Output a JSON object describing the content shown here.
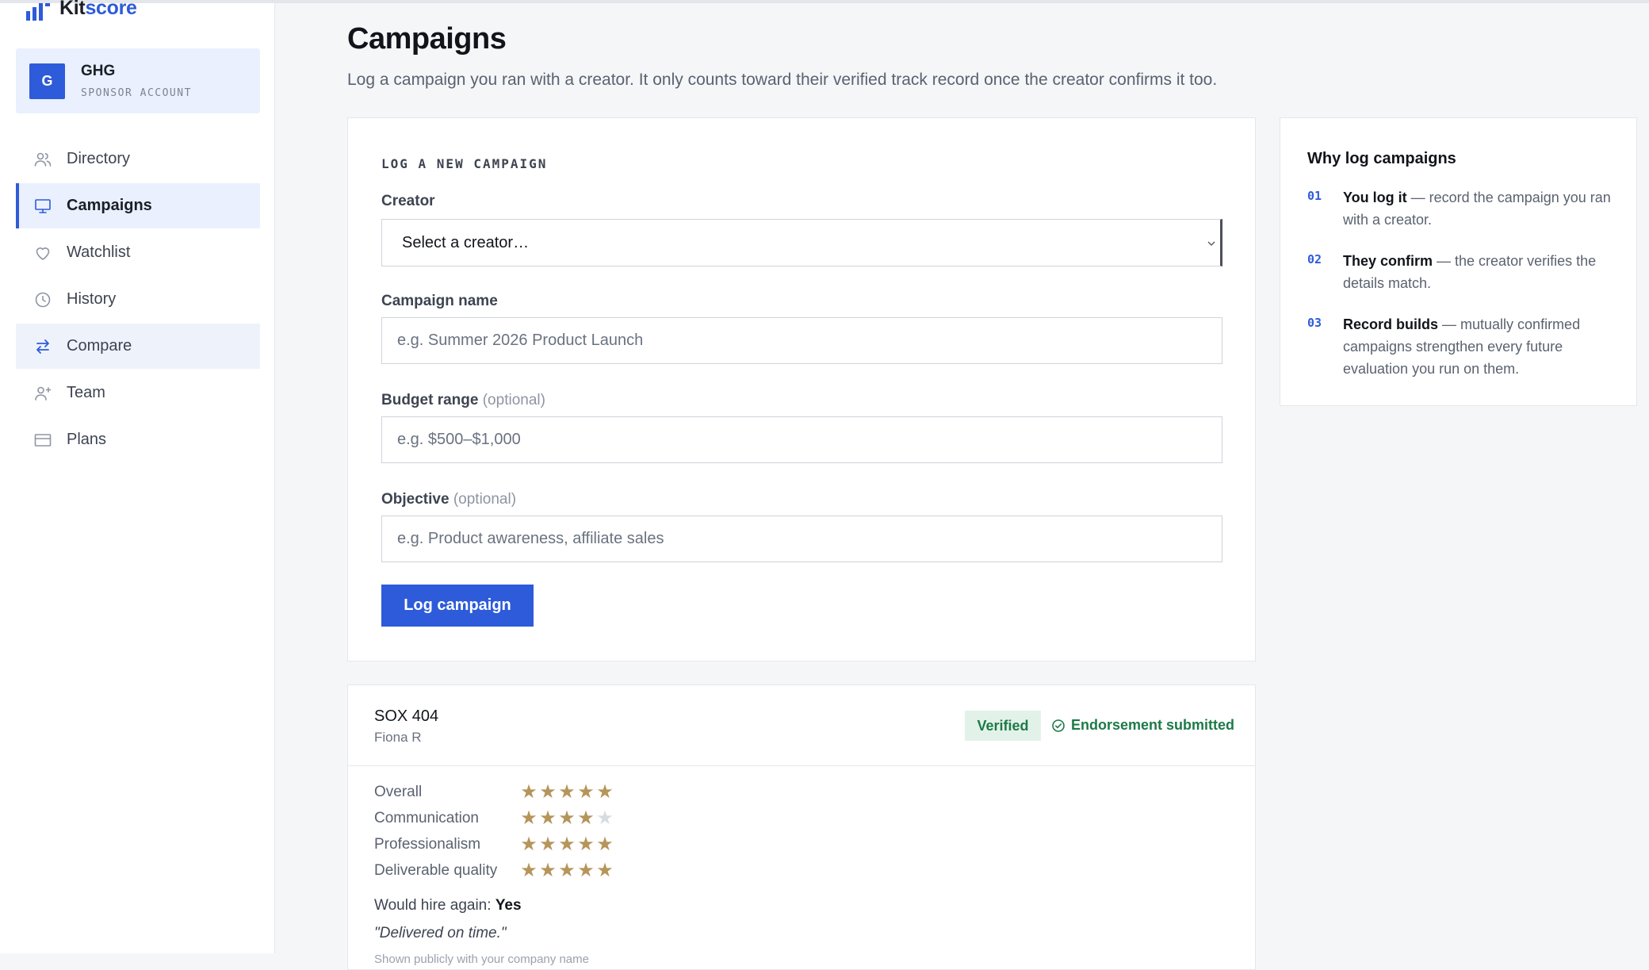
{
  "brand": {
    "name_part1": "Kit",
    "name_part2": "score"
  },
  "account": {
    "initial": "G",
    "name": "GHG",
    "role": "SPONSOR ACCOUNT"
  },
  "nav": {
    "items": [
      {
        "label": "Directory",
        "icon": "users-icon"
      },
      {
        "label": "Campaigns",
        "icon": "monitor-icon"
      },
      {
        "label": "Watchlist",
        "icon": "heart-icon"
      },
      {
        "label": "History",
        "icon": "clock-icon"
      },
      {
        "label": "Compare",
        "icon": "arrows-swap-icon"
      },
      {
        "label": "Team",
        "icon": "user-plus-icon"
      },
      {
        "label": "Plans",
        "icon": "credit-card-icon"
      }
    ],
    "active": "Campaigns"
  },
  "page": {
    "title": "Campaigns",
    "subtitle": "Log a campaign you ran with a creator. It only counts toward their verified track record once the creator confirms it too."
  },
  "form": {
    "heading": "LOG A NEW CAMPAIGN",
    "creator_label": "Creator",
    "creator_selected": "Select a creator…",
    "campaign_name_label": "Campaign name",
    "campaign_name_placeholder": "e.g. Summer 2026 Product Launch",
    "budget_label": "Budget range",
    "budget_optional": "(optional)",
    "budget_placeholder": "e.g. $500–$1,000",
    "objective_label": "Objective",
    "objective_optional": "(optional)",
    "objective_placeholder": "e.g. Product awareness, affiliate sales",
    "submit_label": "Log campaign"
  },
  "why": {
    "title": "Why log campaigns",
    "items": [
      {
        "num": "01",
        "bold": "You log it",
        "text": " — record the campaign you ran with a creator."
      },
      {
        "num": "02",
        "bold": "They confirm",
        "text": " — the creator verifies the details match."
      },
      {
        "num": "03",
        "bold": "Record builds",
        "text": " — mutually confirmed campaigns strengthen every future evaluation you run on them."
      }
    ]
  },
  "campaign": {
    "title": "SOX 404",
    "creator": "Fiona R",
    "status_badge": "Verified",
    "endorsement": "Endorsement submitted",
    "ratings": [
      {
        "label": "Overall",
        "stars": 5,
        "max": 5
      },
      {
        "label": "Communication",
        "stars": 4,
        "max": 5
      },
      {
        "label": "Professionalism",
        "stars": 5,
        "max": 5
      },
      {
        "label": "Deliverable quality",
        "stars": 5,
        "max": 5
      }
    ],
    "hire_label": "Would hire again:",
    "hire_value": "Yes",
    "quote": "\"Delivered on time.\"",
    "note": "Shown publicly with your company name"
  },
  "colors": {
    "accent": "#2e5bd9",
    "star": "#b6955b",
    "verified_bg": "#e3f2e9",
    "verified_text": "#1d7a48"
  }
}
